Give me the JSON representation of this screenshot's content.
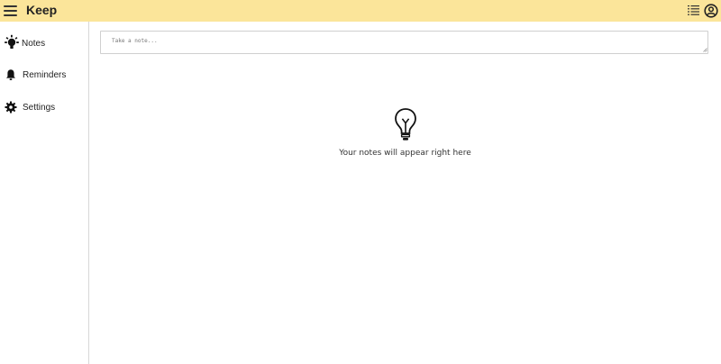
{
  "header": {
    "title": "Keep",
    "menu_icon": "hamburger-menu-icon",
    "actions": [
      {
        "icon": "list-view-icon"
      },
      {
        "icon": "account-circle-icon"
      }
    ],
    "background": "#fbe59a"
  },
  "sidebar": {
    "items": [
      {
        "label": "Notes",
        "icon": "lightbulb-icon",
        "active": true
      },
      {
        "label": "Reminders",
        "icon": "bell-icon",
        "active": false
      },
      {
        "label": "Settings",
        "icon": "gear-icon",
        "active": false
      }
    ]
  },
  "main": {
    "note_input": {
      "placeholder": "Take a note...",
      "value": ""
    },
    "empty_state": {
      "icon": "lightbulb-outline-icon",
      "text": "Your notes will appear right here"
    }
  }
}
